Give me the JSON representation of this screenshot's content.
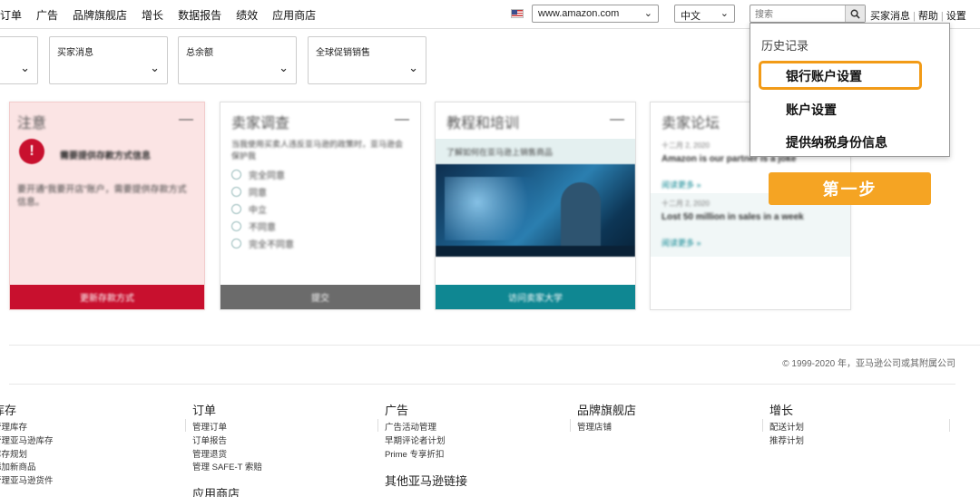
{
  "nav": {
    "items": [
      "订单",
      "广告",
      "品牌旗舰店",
      "增长",
      "数据报告",
      "绩效",
      "应用商店"
    ],
    "market": "www.amazon.com",
    "language": "中文",
    "search_placeholder": "搜索",
    "utility": [
      "买家消息",
      "帮助",
      "设置"
    ]
  },
  "filters": [
    "",
    "买家消息",
    "总余额",
    "全球促销销售"
  ],
  "cards": {
    "notice": {
      "title": "注意",
      "alert_text": "需要提供存款方式信息",
      "body": "要开通“我要开店”账户，需要提供存款方式信息。",
      "button": "更新存款方式"
    },
    "survey": {
      "title": "卖家调查",
      "question": "当我使用买卖人违反亚马逊的政策时，亚马逊会保护我",
      "options": [
        "完全同意",
        "同意",
        "中立",
        "不同意",
        "完全不同意"
      ],
      "button": "提交"
    },
    "training": {
      "title": "教程和培训",
      "banner": "了解如何在亚马逊上销售商品",
      "button": "访问卖家大学"
    },
    "forum": {
      "title": "卖家论坛",
      "posts": [
        {
          "date": "十二月 2, 2020",
          "title": "Amazon is our partner is a joke",
          "more": "阅读更多 »"
        },
        {
          "date": "十二月 2, 2020",
          "title": "Lost 50 million in sales in a week",
          "more": "阅读更多 »"
        }
      ]
    }
  },
  "history": {
    "title": "历史记录",
    "items": [
      "银行账户设置",
      "账户设置",
      "提供纳税身份信息"
    ]
  },
  "step_label": "第一步",
  "copyright": "© 1999-2020 年，亚马逊公司或其附属公司",
  "footer": {
    "inventory": {
      "heading": "库存",
      "links": [
        "管理库存",
        "管理亚马逊库存",
        "库存规划",
        "添加新商品",
        "管理亚马逊货件"
      ]
    },
    "orders": {
      "heading": "订单",
      "links": [
        "管理订单",
        "订单报告",
        "管理退货",
        "管理 SAFE-T 索赔"
      ]
    },
    "apps": {
      "heading": "应用商店"
    },
    "ads": {
      "heading": "广告",
      "links": [
        "广告活动管理",
        "早期评论者计划",
        "Prime 专享折扣"
      ]
    },
    "other": {
      "heading": "其他亚马逊链接"
    },
    "brand": {
      "heading": "品牌旗舰店",
      "links": [
        "管理店铺"
      ]
    },
    "growth": {
      "heading": "增长",
      "links": [
        "配送计划",
        "推荐计划"
      ]
    }
  },
  "colors": {
    "accent_orange": "#f5a423",
    "alert_red": "#c8102e",
    "teal": "#0f8792",
    "gray_button": "#6b6b6b"
  }
}
